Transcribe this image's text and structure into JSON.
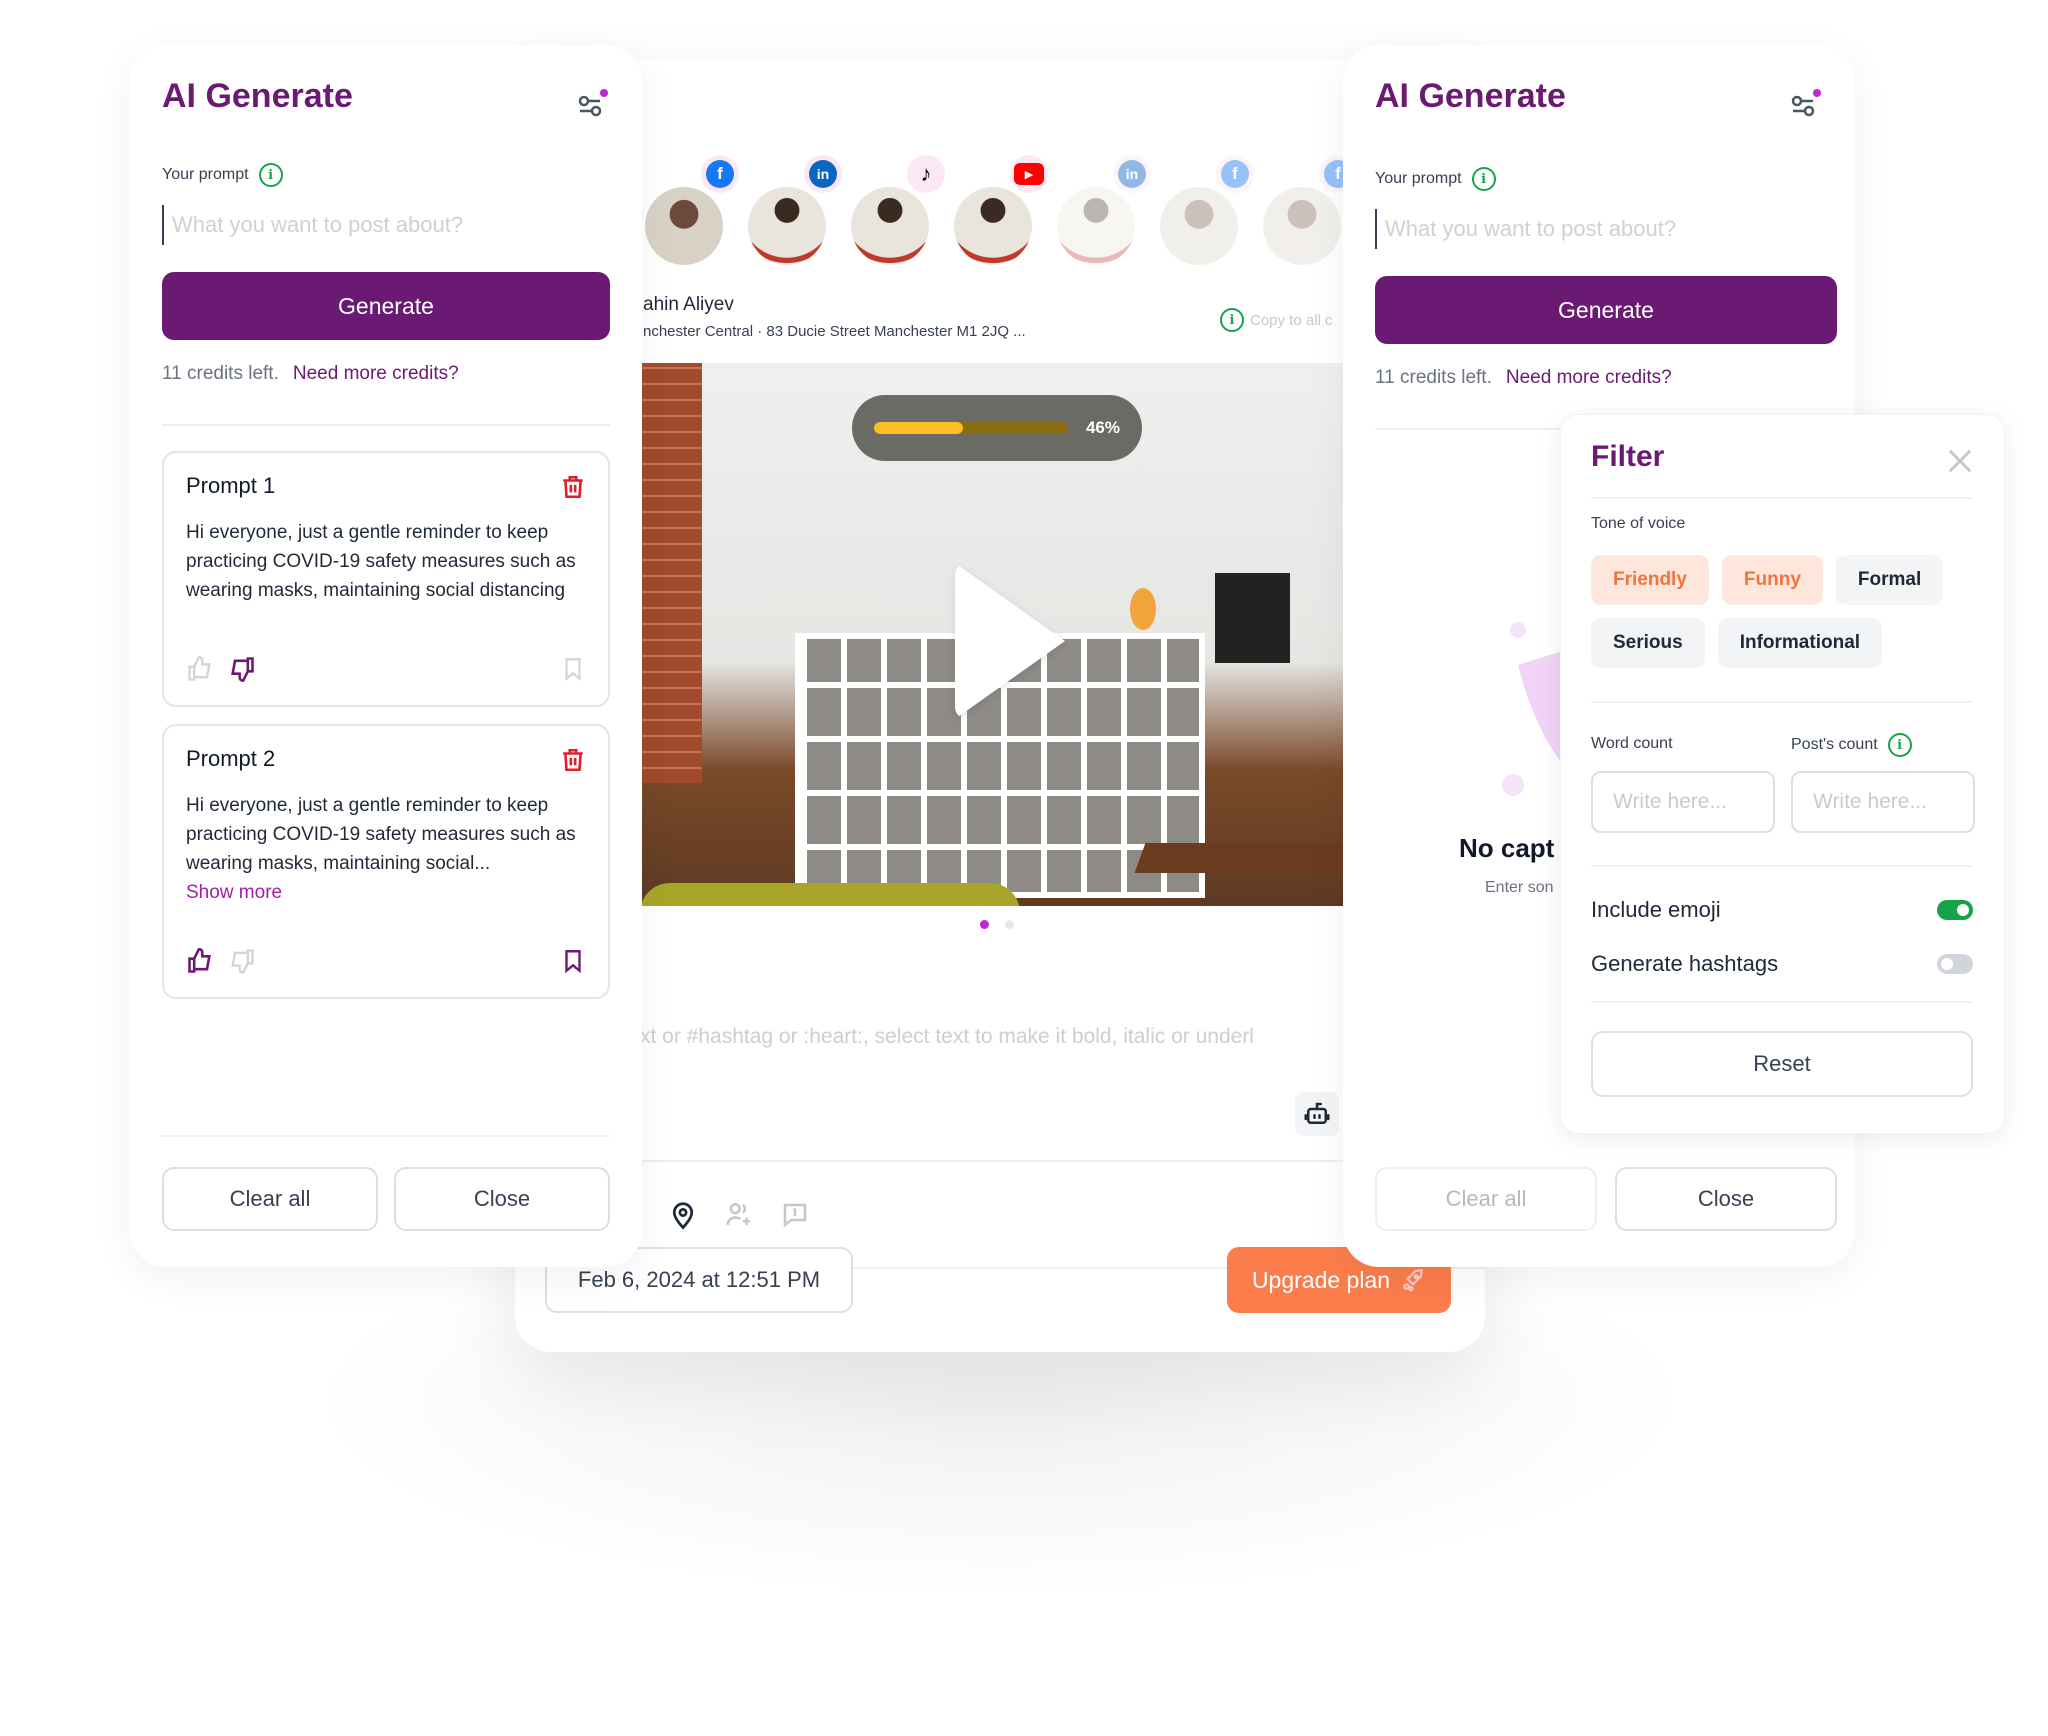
{
  "left_panel": {
    "title": "AI Generate",
    "prompt_label": "Your prompt",
    "prompt_placeholder": "What you want to post about?",
    "generate_label": "Generate",
    "credits_text": "11 credits left.",
    "credits_link": "Need more credits?",
    "prompts": [
      {
        "title": "Prompt 1",
        "body": "Hi everyone, just a gentle reminder to keep practicing COVID-19 safety measures such as wearing masks, maintaining social distancing",
        "liked": false,
        "disliked": true,
        "bookmarked": false
      },
      {
        "title": "Prompt 2",
        "body": "Hi everyone, just a gentle reminder to keep practicing COVID-19 safety measures such as wearing masks, maintaining social...",
        "show_more": "Show more",
        "liked": true,
        "disliked": false,
        "bookmarked": true
      }
    ],
    "clear_all_label": "Clear all",
    "close_label": "Close"
  },
  "post_editor": {
    "accounts": [
      {
        "network": "facebook",
        "avatar": "man",
        "active": true
      },
      {
        "network": "linkedin",
        "avatar": "woman",
        "active": true
      },
      {
        "network": "tiktok",
        "avatar": "woman",
        "active": true
      },
      {
        "network": "youtube",
        "avatar": "woman",
        "active": true
      },
      {
        "network": "linkedin",
        "avatar": "woman",
        "active": false
      },
      {
        "network": "facebook",
        "avatar": "man",
        "active": false
      },
      {
        "network": "facebook",
        "avatar": "man",
        "active": false
      }
    ],
    "author_name": "ahin Aliyev",
    "location": "nchester Central · 83 Ducie Street Manchester M1 2JQ ...",
    "copy_to_all": "Copy to all c",
    "upload_progress_percent": 46,
    "upload_progress_label": "46%",
    "carousel_total": 2,
    "carousel_active": 1,
    "caption_placeholder": "xt or #hashtag or :heart:, select text to make it bold, italic or underl",
    "schedule_date": "Feb 6, 2024 at 12:51 PM",
    "upgrade_label": "Upgrade plan"
  },
  "right_panel": {
    "title": "AI Generate",
    "prompt_label": "Your prompt",
    "prompt_placeholder": "What you want to post about?",
    "generate_label": "Generate",
    "credits_text": "11 credits left.",
    "credits_link": "Need more credits?",
    "empty_title": "No capt",
    "empty_subtitle": "Enter son",
    "clear_all_label": "Clear all",
    "close_label": "Close"
  },
  "filter": {
    "title": "Filter",
    "tone_label": "Tone of voice",
    "tones": [
      {
        "label": "Friendly",
        "selected": true
      },
      {
        "label": "Funny",
        "selected": true
      },
      {
        "label": "Formal",
        "selected": false
      },
      {
        "label": "Serious",
        "selected": false
      },
      {
        "label": "Informational",
        "selected": false
      }
    ],
    "word_count_label": "Word count",
    "word_count_placeholder": "Write here...",
    "posts_count_label": "Post's count",
    "posts_count_placeholder": "Write here...",
    "include_emoji_label": "Include emoji",
    "include_emoji": true,
    "generate_hashtags_label": "Generate hashtags",
    "generate_hashtags": false,
    "reset_label": "Reset"
  },
  "colors": {
    "brand_purple": "#6b1a73",
    "accent_orange": "#fb7d4b",
    "success_green": "#16a34a",
    "danger_red": "#e11d2a",
    "progress_yellow": "#fbbf24",
    "notification_dot": "#c026d3"
  }
}
